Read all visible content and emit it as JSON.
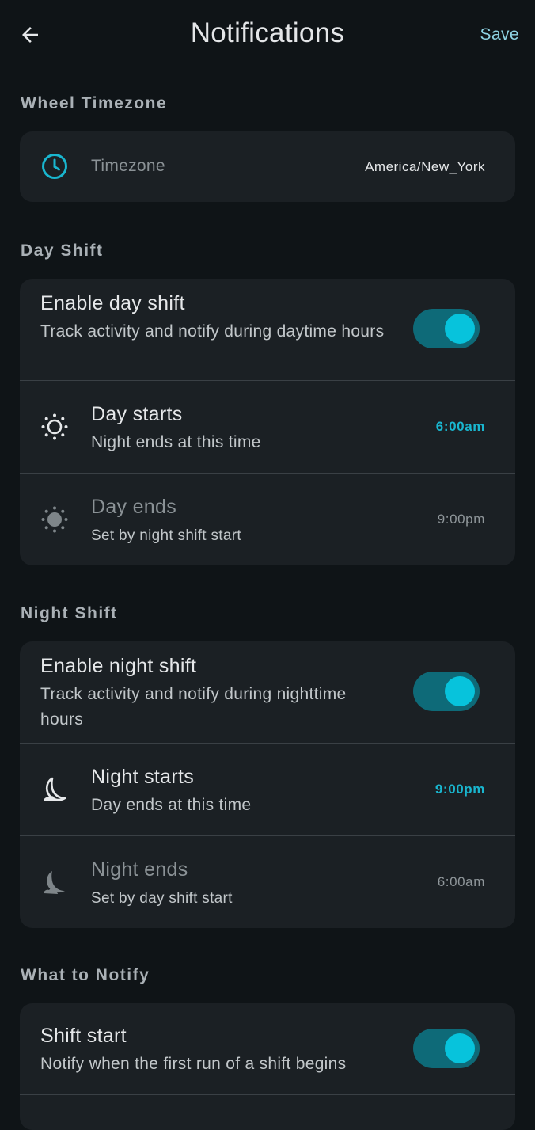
{
  "header": {
    "title": "Notifications",
    "save_label": "Save"
  },
  "timezone_section": {
    "label": "Wheel Timezone",
    "field_label": "Timezone",
    "value": "America/New_York"
  },
  "day_shift": {
    "label": "Day Shift",
    "enable_title": "Enable day shift",
    "enable_subtitle": "Track activity and notify during daytime hours",
    "enabled": true,
    "starts_title": "Day starts",
    "starts_subtitle": "Night ends at this time",
    "starts_value": "6:00am",
    "ends_title": "Day ends",
    "ends_subtitle": "Set by night shift start",
    "ends_value": "9:00pm"
  },
  "night_shift": {
    "label": "Night Shift",
    "enable_title": "Enable night shift",
    "enable_subtitle": "Track activity and notify during nighttime hours",
    "enabled": true,
    "starts_title": "Night starts",
    "starts_subtitle": "Day ends at this time",
    "starts_value": "9:00pm",
    "ends_title": "Night ends",
    "ends_subtitle": "Set by day shift start",
    "ends_value": "6:00am"
  },
  "what_to_notify": {
    "label": "What to Notify",
    "shift_start_title": "Shift start",
    "shift_start_subtitle": "Notify when the first run of a shift begins",
    "shift_start_enabled": true
  },
  "colors": {
    "background": "#0f1417",
    "card": "#1b2024",
    "accent": "#07c3dc",
    "switch_track": "#0e6a78",
    "save_text": "#8ed3e3"
  },
  "icons": [
    "back-arrow-icon",
    "clock-icon",
    "sun-icon",
    "sun-filled-icon",
    "moon-icon",
    "moon-filled-icon"
  ]
}
